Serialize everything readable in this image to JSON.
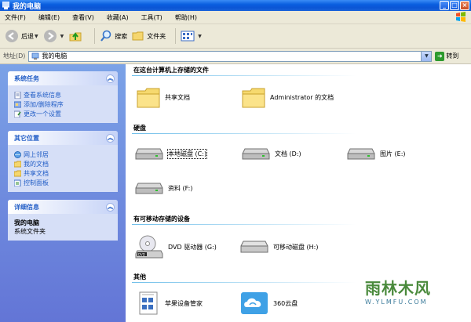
{
  "window": {
    "title": "我的电脑"
  },
  "menu": [
    "文件(F)",
    "编辑(E)",
    "查看(V)",
    "收藏(A)",
    "工具(T)",
    "帮助(H)"
  ],
  "toolbar": {
    "back": "后退",
    "search": "搜索",
    "folders": "文件夹"
  },
  "address": {
    "label": "地址(D)",
    "value": "我的电脑",
    "go": "转到"
  },
  "sidebar": {
    "system_tasks": {
      "title": "系统任务",
      "items": [
        "查看系统信息",
        "添加/删除程序",
        "更改一个设置"
      ]
    },
    "other_places": {
      "title": "其它位置",
      "items": [
        "网上邻居",
        "我的文档",
        "共享文档",
        "控制面板"
      ]
    },
    "details": {
      "title": "详细信息",
      "name": "我的电脑",
      "type": "系统文件夹"
    }
  },
  "groups": {
    "stored_files": {
      "title": "在这台计算机上存储的文件",
      "items": [
        "共享文档",
        "Administrator 的文档"
      ]
    },
    "hard_disks": {
      "title": "硬盘",
      "items": [
        "本地磁盘 (C:)",
        "文档 (D:)",
        "图片 (E:)",
        "资料 (F:)"
      ]
    },
    "removable": {
      "title": "有可移动存储的设备",
      "items": [
        "DVD 驱动器 (G:)",
        "可移动磁盘 (H:)"
      ]
    },
    "other": {
      "title": "其他",
      "items": [
        "苹果设备管家",
        "360云盘"
      ]
    }
  },
  "watermark": {
    "text": "雨林木风",
    "url": "W.YLMFU.COM"
  },
  "colors": {
    "title_bar": "#0a5fe0",
    "sidebar_bg": "#6f8fe0",
    "panel_header_text": "#215dc6",
    "group_line": "#70bfea"
  }
}
